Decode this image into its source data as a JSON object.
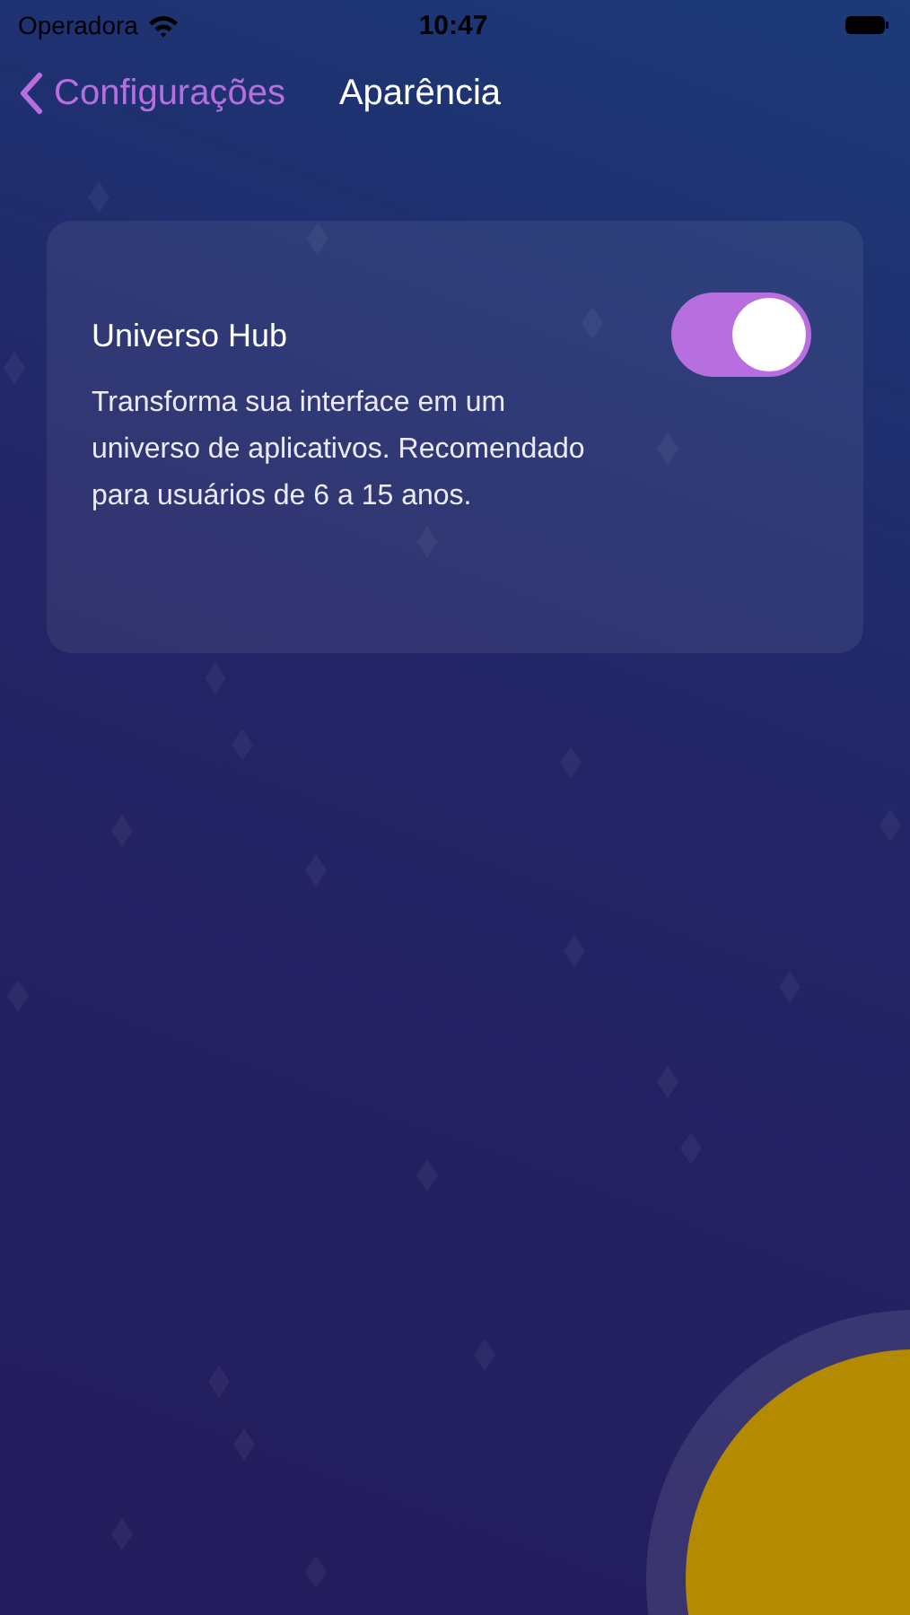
{
  "status_bar": {
    "carrier": "Operadora",
    "time": "10:47"
  },
  "nav": {
    "back_label": "Configurações",
    "title": "Aparência"
  },
  "setting": {
    "title": "Universo Hub",
    "description": "Transforma sua interface em um universo de aplicativos. Recomendado para usuários de 6 a 15 anos.",
    "on": true
  }
}
